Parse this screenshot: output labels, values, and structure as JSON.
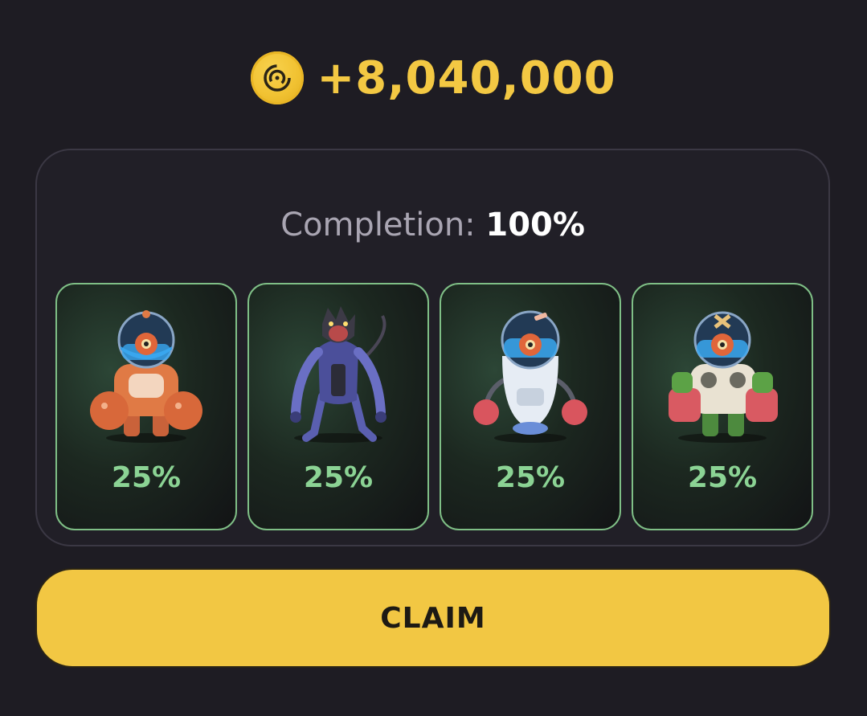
{
  "reward": {
    "icon": "spiral-coin-icon",
    "amount": "+8,040,000",
    "color": "#f3c843"
  },
  "completion": {
    "label": "Completion:",
    "value": "100%",
    "fraction": 1.0
  },
  "characters": [
    {
      "icon": "orange-diver-robot-icon",
      "percent": "25%"
    },
    {
      "icon": "purple-werewolf-mech-icon",
      "percent": "25%"
    },
    {
      "icon": "white-egg-boxer-robot-icon",
      "percent": "25%"
    },
    {
      "icon": "green-diver-robot-icon",
      "percent": "25%"
    }
  ],
  "claim_button": {
    "label": "CLAIM",
    "color": "#f2c743"
  }
}
